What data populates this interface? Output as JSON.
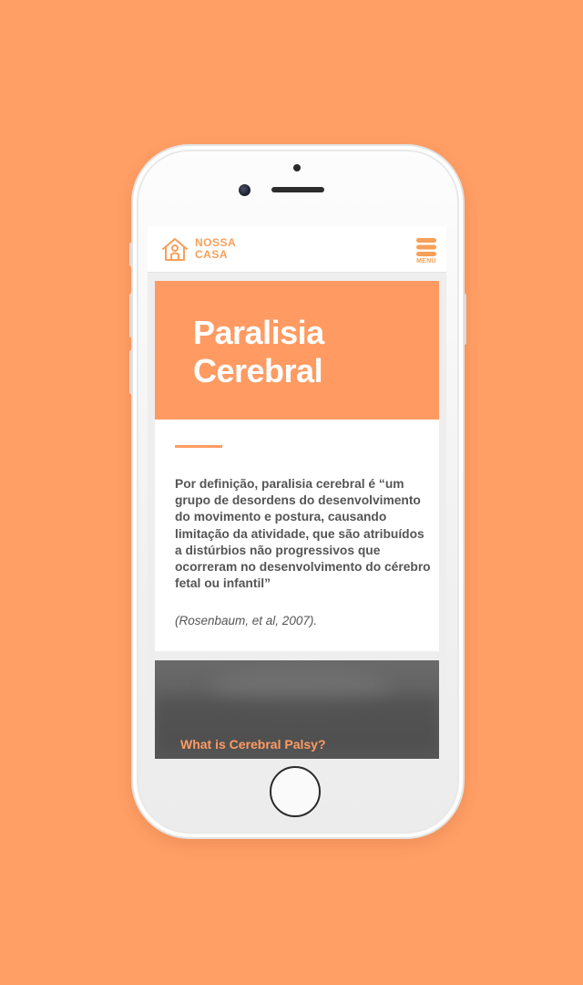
{
  "brand": {
    "name_line1": "NOSSA",
    "name_line2": "CASA",
    "accent_color": "#ff9b62",
    "logo_icon": "house-person-icon"
  },
  "header": {
    "menu_label": "MENU",
    "menu_icon": "hamburger-menu-icon"
  },
  "hero": {
    "title": "Paralisia Cerebral"
  },
  "article": {
    "definition": "Por definição, paralisia cerebral é “um grupo de desordens do desenvolvimento do movimento e postura, causando limitação da atividade, que são atribuídos a distúrbios não progressivos que ocorreram no desenvolvimento do cérebro fetal ou infantil”",
    "citation": "(Rosenbaum, et al, 2007)."
  },
  "video_card": {
    "title": "What is Cerebral Palsy?"
  },
  "colors": {
    "background": "#ff9e65",
    "text": "#555555",
    "logo": "#f7a05a"
  }
}
